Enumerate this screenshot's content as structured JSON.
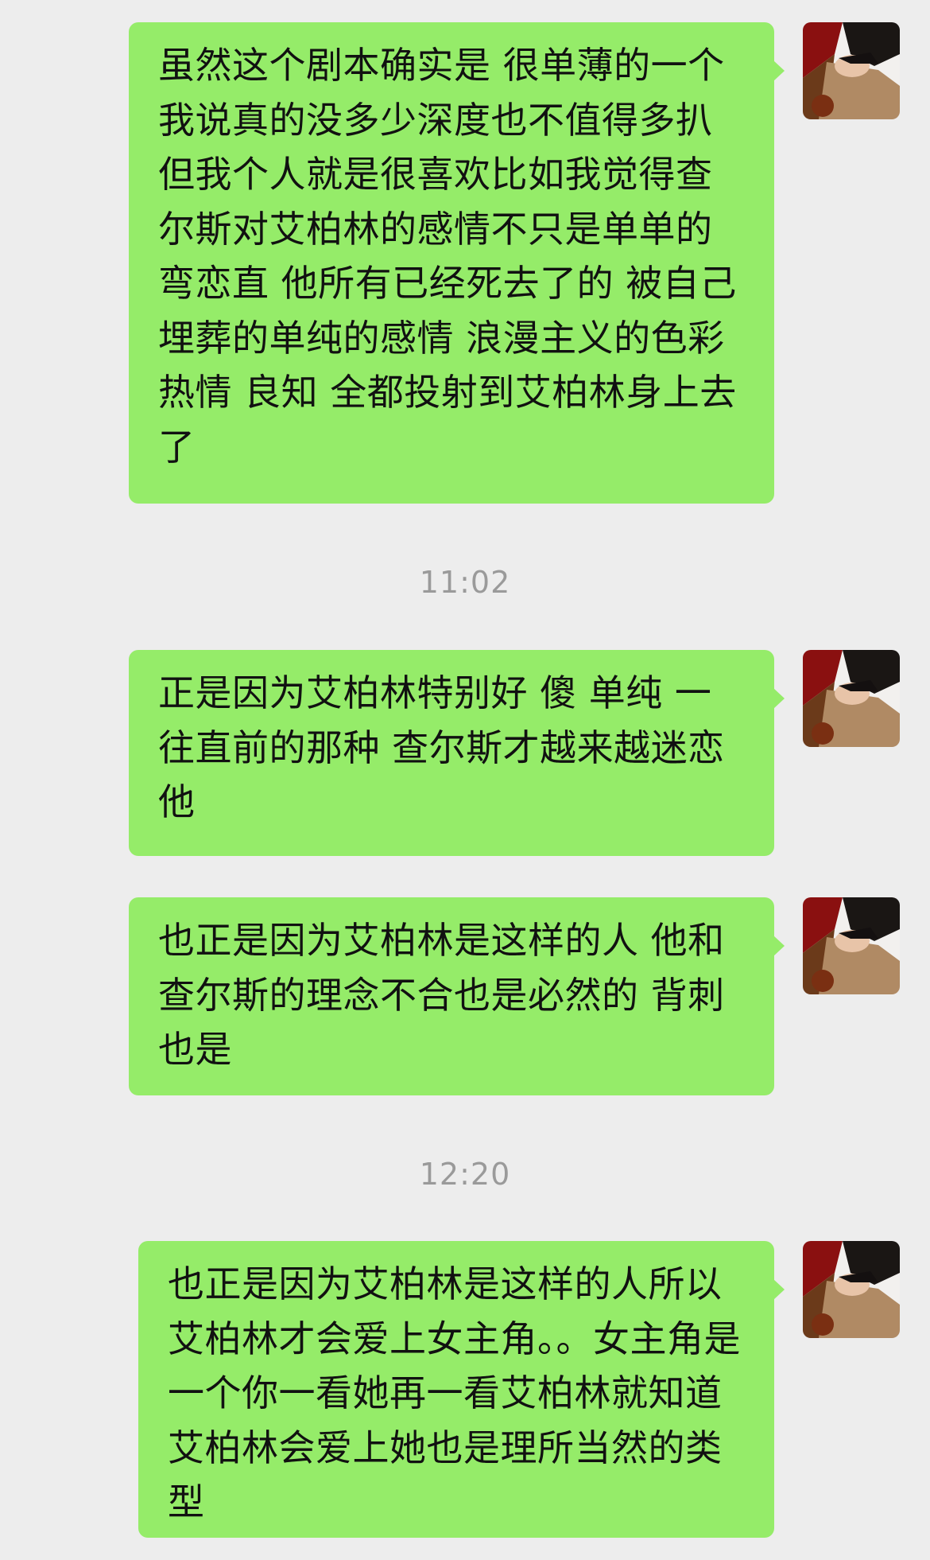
{
  "messages": [
    {
      "text": "虽然这个剧本确实是 很单薄的一个 我说真的没多少深度也不值得多扒 但我个人就是很喜欢比如我觉得查尔斯对艾柏林的感情不只是单单的弯恋直 他所有已经死去了的 被自己埋葬的单纯的感情 浪漫主义的色彩 热情 良知 全都投射到艾柏林身上去了",
      "sender": "self"
    },
    {
      "text": "正是因为艾柏林特别好 傻 单纯 一往直前的那种 查尔斯才越来越迷恋他",
      "sender": "self"
    },
    {
      "text": "也正是因为艾柏林是这样的人 他和查尔斯的理念不合也是必然的 背刺也是",
      "sender": "self"
    },
    {
      "text": "也正是因为艾柏林是这样的人所以艾柏林才会爱上女主角。。女主角是一个你一看她再一看艾柏林就知道艾柏林会爱上她也是理所当然的类型",
      "sender": "self"
    }
  ],
  "timestamps": [
    "11:02",
    "12:20"
  ],
  "avatar_icon": "user-avatar-photo",
  "colors": {
    "background": "#ededed",
    "bubble": "#95ec69",
    "text": "#111111",
    "timestamp": "#9a9a9a"
  }
}
